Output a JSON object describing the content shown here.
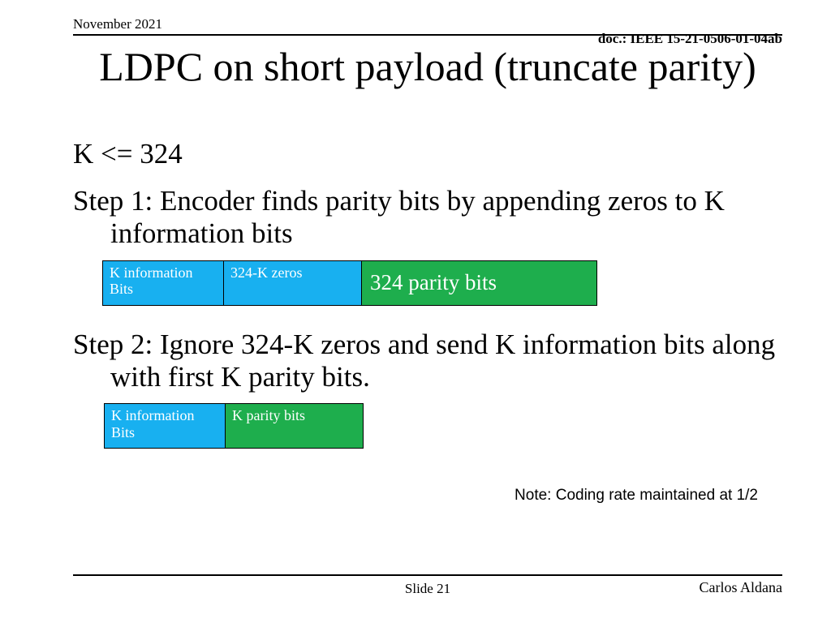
{
  "header": {
    "date": "November 2021",
    "doc": "doc.: IEEE 15-21-0506-01-04ab"
  },
  "title": "LDPC on short payload (truncate parity)",
  "k_constraint": "K <= 324",
  "step1": "Step 1:  Encoder finds parity bits by appending zeros to K information bits",
  "diagram1": {
    "info": "K information Bits",
    "zeros": "324-K zeros",
    "parity": "324 parity bits"
  },
  "step2": "Step 2: Ignore 324-K zeros and send K information bits along with first K parity bits.",
  "diagram2": {
    "info": "K information Bits",
    "parity": "K parity bits"
  },
  "note": "Note: Coding rate maintained at 1/2",
  "footer": {
    "slide": "Slide 21",
    "author": "Carlos Aldana"
  }
}
